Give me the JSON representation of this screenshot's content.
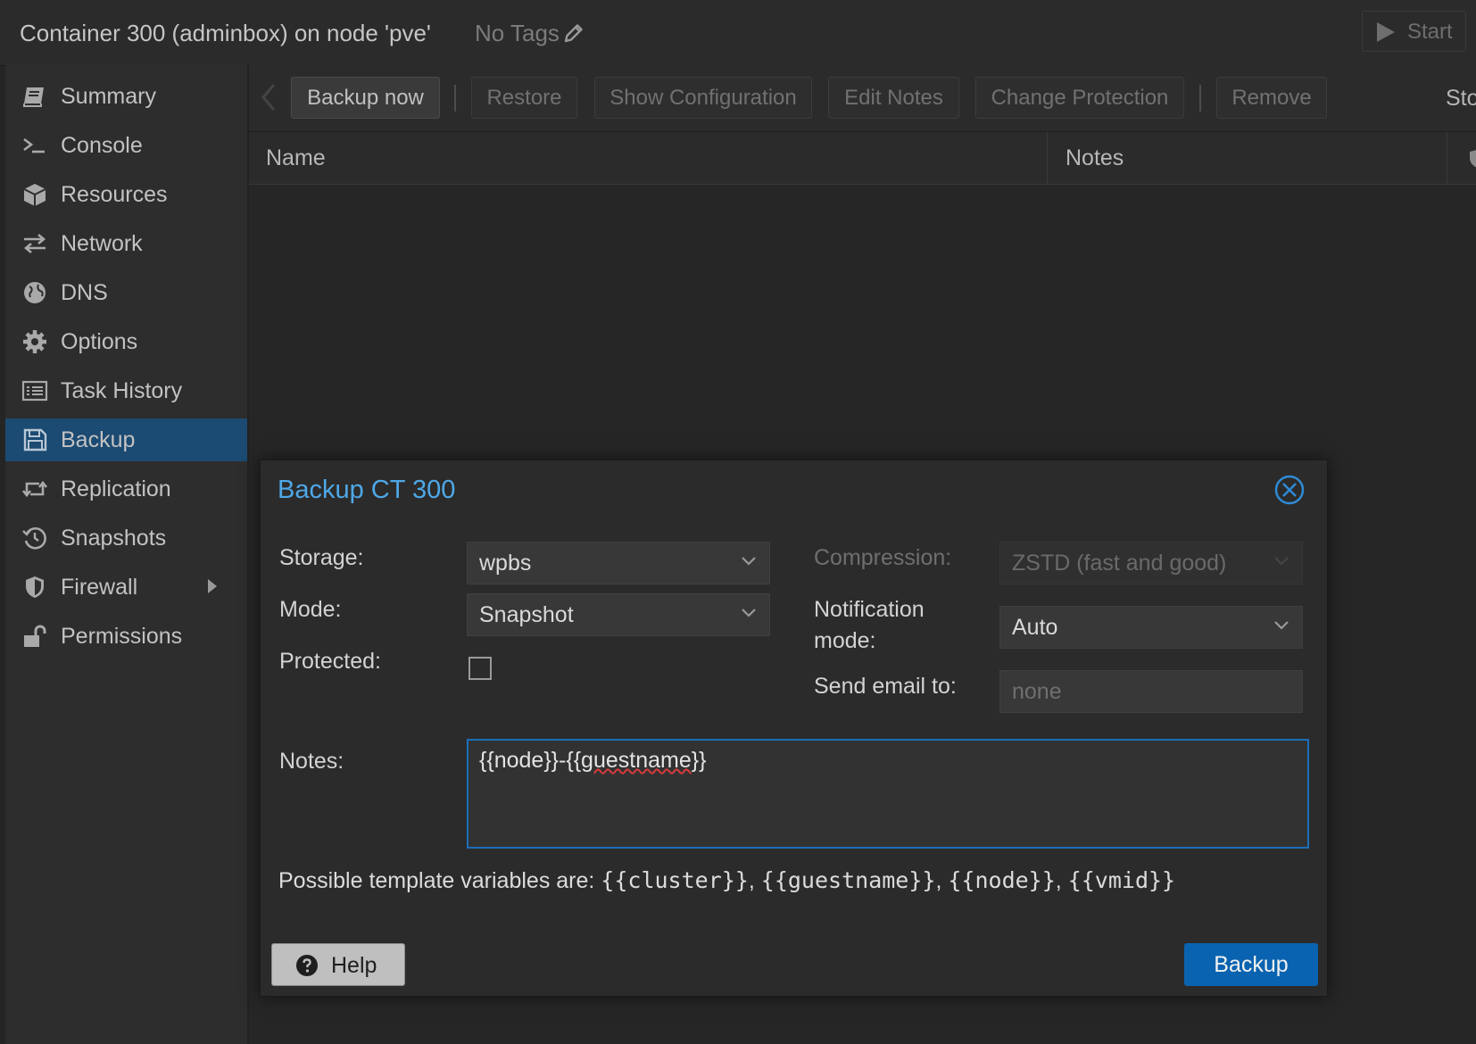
{
  "header": {
    "title": "Container 300 (adminbox) on node 'pve'",
    "tags_label": "No Tags",
    "start_label": "Start"
  },
  "sidebar": {
    "items": [
      {
        "label": "Summary",
        "icon": "book-icon"
      },
      {
        "label": "Console",
        "icon": "terminal-icon"
      },
      {
        "label": "Resources",
        "icon": "cube-icon"
      },
      {
        "label": "Network",
        "icon": "exchange-icon"
      },
      {
        "label": "DNS",
        "icon": "globe-icon"
      },
      {
        "label": "Options",
        "icon": "gear-icon"
      },
      {
        "label": "Task History",
        "icon": "list-icon"
      },
      {
        "label": "Backup",
        "icon": "floppy-icon",
        "active": true
      },
      {
        "label": "Replication",
        "icon": "retweet-icon"
      },
      {
        "label": "Snapshots",
        "icon": "history-icon"
      },
      {
        "label": "Firewall",
        "icon": "shield-icon"
      },
      {
        "label": "Permissions",
        "icon": "unlock-icon"
      }
    ]
  },
  "toolbar": {
    "backup_now": "Backup now",
    "restore": "Restore",
    "show_configuration": "Show Configuration",
    "edit_notes": "Edit Notes",
    "change_protection": "Change Protection",
    "remove": "Remove",
    "cut_label": "Sto"
  },
  "grid": {
    "columns": [
      "Name",
      "Notes"
    ]
  },
  "dialog": {
    "title": "Backup CT 300",
    "storage_label": "Storage:",
    "storage_value": "wpbs",
    "mode_label": "Mode:",
    "mode_value": "Snapshot",
    "protected_label": "Protected:",
    "compression_label": "Compression:",
    "compression_value": "ZSTD (fast and good)",
    "notification_label_1": "Notification",
    "notification_label_2": "mode:",
    "notification_value": "Auto",
    "email_label": "Send email to:",
    "email_placeholder": "none",
    "notes_label": "Notes:",
    "notes_value_part1": "{{node}}-{{",
    "notes_value_typo": "guestname",
    "notes_value_part2": "}}",
    "template_hint_prefix": "Possible template variables are: ",
    "template_vars": [
      "{{cluster}}",
      "{{guestname}}",
      "{{node}}",
      "{{vmid}}"
    ],
    "help_label": "Help",
    "backup_label": "Backup"
  },
  "colors": {
    "accent": "#4ea8e8",
    "primary_button": "#0a63b0",
    "active_nav": "#1b4a72"
  }
}
